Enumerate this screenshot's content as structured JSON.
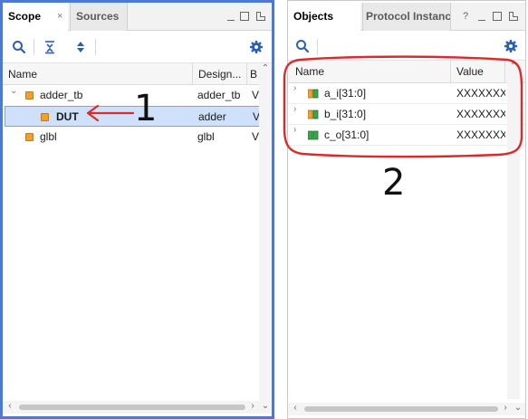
{
  "scope_panel": {
    "tabs": [
      {
        "label": "Scope",
        "active": true,
        "close": "×"
      },
      {
        "label": "Sources",
        "active": false
      }
    ],
    "columns": [
      "Name",
      "Design...",
      "B"
    ],
    "rows": [
      {
        "name": "adder_tb",
        "design": "adder_tb",
        "b": "V"
      },
      {
        "name": "DUT",
        "design": "adder",
        "b": "V"
      },
      {
        "name": "glbl",
        "design": "glbl",
        "b": "V"
      }
    ]
  },
  "objects_panel": {
    "tabs": [
      {
        "label": "Objects",
        "active": true
      },
      {
        "label": "Protocol Instanc",
        "active": false
      }
    ],
    "help": "?",
    "columns": [
      "Name",
      "Value"
    ],
    "rows": [
      {
        "name": "a_i[31:0]",
        "value": "XXXXXXX"
      },
      {
        "name": "b_i[31:0]",
        "value": "XXXXXXX"
      },
      {
        "name": "c_o[31:0]",
        "value": "XXXXXXX"
      }
    ]
  },
  "annotations": {
    "label_1": "1",
    "label_2": "2"
  },
  "colors": {
    "highlight_border": "#4a7bd0",
    "annotation_red": "#d92b2b",
    "selection": "#cfe0fb",
    "signal_icon_green": "#3ea34a",
    "signal_icon_orange": "#f0a030"
  },
  "icons": {
    "search": "search-icon",
    "collapse_all": "collapse-all-icon",
    "expand_all": "expand-all-icon",
    "settings": "gear-icon"
  }
}
